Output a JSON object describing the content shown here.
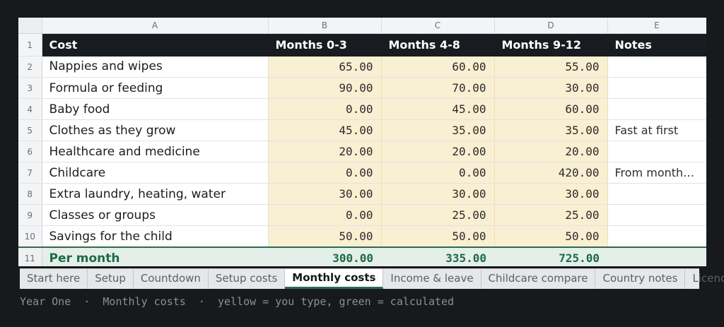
{
  "columns": [
    "A",
    "B",
    "C",
    "D",
    "E"
  ],
  "headers": {
    "row": "1",
    "a": "Cost",
    "b": "Months 0-3",
    "c": "Months 4-8",
    "d": "Months 9-12",
    "e": "Notes"
  },
  "rows": [
    {
      "n": "2",
      "label": "Nappies and wipes",
      "b": "65.00",
      "c": "60.00",
      "d": "55.00",
      "e": ""
    },
    {
      "n": "3",
      "label": "Formula or feeding",
      "b": "90.00",
      "c": "70.00",
      "d": "30.00",
      "e": ""
    },
    {
      "n": "4",
      "label": "Baby food",
      "b": "0.00",
      "c": "45.00",
      "d": "60.00",
      "e": ""
    },
    {
      "n": "5",
      "label": "Clothes as they grow",
      "b": "45.00",
      "c": "35.00",
      "d": "35.00",
      "e": "Fast at first"
    },
    {
      "n": "6",
      "label": "Healthcare and medicine",
      "b": "20.00",
      "c": "20.00",
      "d": "20.00",
      "e": ""
    },
    {
      "n": "7",
      "label": "Childcare",
      "b": "0.00",
      "c": "0.00",
      "d": "420.00",
      "e": "From month…"
    },
    {
      "n": "8",
      "label": "Extra laundry, heating, water",
      "b": "30.00",
      "c": "30.00",
      "d": "30.00",
      "e": ""
    },
    {
      "n": "9",
      "label": "Classes or groups",
      "b": "0.00",
      "c": "25.00",
      "d": "25.00",
      "e": ""
    },
    {
      "n": "10",
      "label": "Savings for the child",
      "b": "50.00",
      "c": "50.00",
      "d": "50.00",
      "e": ""
    }
  ],
  "total": {
    "n": "11",
    "label": "Per month",
    "b": "300.00",
    "c": "335.00",
    "d": "725.00",
    "e": ""
  },
  "tabs": [
    {
      "label": "Start here"
    },
    {
      "label": "Setup"
    },
    {
      "label": "Countdown"
    },
    {
      "label": "Setup costs"
    },
    {
      "label": "Monthly costs",
      "active": true
    },
    {
      "label": "Income & leave"
    },
    {
      "label": "Childcare compare"
    },
    {
      "label": "Country notes"
    },
    {
      "label": "Licence"
    }
  ],
  "footer": "Year One  ·  Monthly costs  ·  yellow = you type, green = calculated",
  "colors": {
    "input": "#f9efd2",
    "calculated": "#e4efea",
    "header": "#181b1f",
    "accent": "#2f6a4e"
  }
}
